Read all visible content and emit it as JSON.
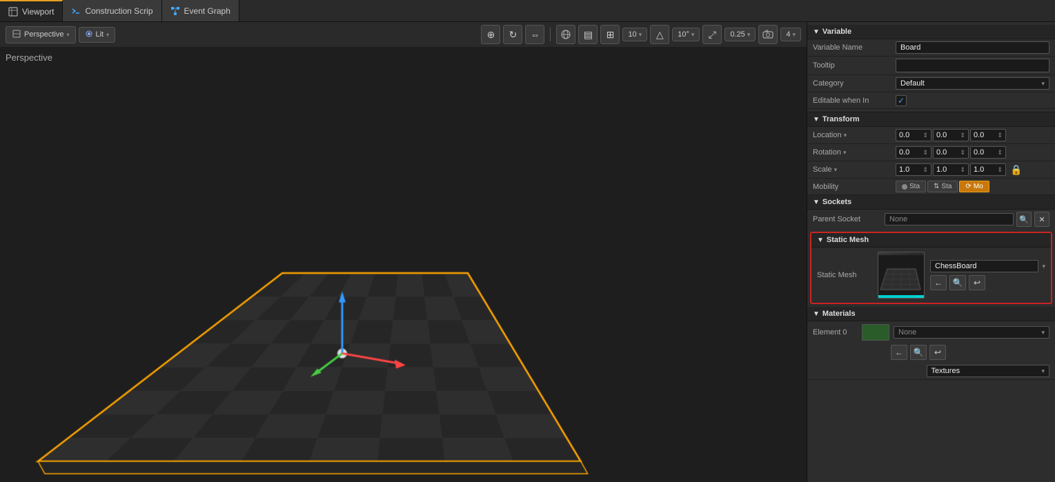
{
  "tabs": [
    {
      "id": "viewport",
      "label": "Viewport",
      "icon": "viewport-icon",
      "active": true
    },
    {
      "id": "construction",
      "label": "Construction Scrip",
      "icon": "script-icon",
      "active": false
    },
    {
      "id": "event-graph",
      "label": "Event Graph",
      "icon": "graph-icon",
      "active": false
    }
  ],
  "viewport": {
    "perspective_label": "Perspective",
    "lit_label": "Lit",
    "toolbar": {
      "translate_icon": "⊕",
      "rotate_icon": "↻",
      "scale_icon": "↔",
      "surface_icon": "▤",
      "grid_icon": "⊞",
      "snap_value": "10",
      "angle_value": "10°",
      "scale_snap": "0.25",
      "number_4": "4"
    }
  },
  "right_panel": {
    "variable_section": {
      "title": "Variable",
      "fields": [
        {
          "label": "Variable Name",
          "value": "Board"
        },
        {
          "label": "Tooltip",
          "value": ""
        },
        {
          "label": "Category",
          "value": "Default"
        },
        {
          "label": "Editable when In",
          "checked": true
        }
      ]
    },
    "transform_section": {
      "title": "Transform",
      "location": {
        "label": "Location",
        "x": "0.0",
        "y": "0.0",
        "z": "0.0"
      },
      "rotation": {
        "label": "Rotation",
        "x": "0.0",
        "y": "0.0",
        "z": "0.0"
      },
      "scale": {
        "label": "Scale",
        "x": "1.0",
        "y": "1.0",
        "z": "1.0"
      },
      "mobility": {
        "label": "Mobility",
        "options": [
          "Sta",
          "Sta",
          "Mo"
        ],
        "active_index": 2
      }
    },
    "sockets_section": {
      "title": "Sockets",
      "parent_socket": {
        "label": "Parent Socket",
        "value": "None"
      }
    },
    "static_mesh_section": {
      "title": "Static Mesh",
      "highlighted": true,
      "mesh_label": "Static Mesh",
      "mesh_name": "ChessBoard"
    },
    "materials_section": {
      "title": "Materials",
      "element0_label": "Element 0",
      "element0_value": "None",
      "material_dropdown": "None",
      "textures_label": "Textures"
    }
  }
}
